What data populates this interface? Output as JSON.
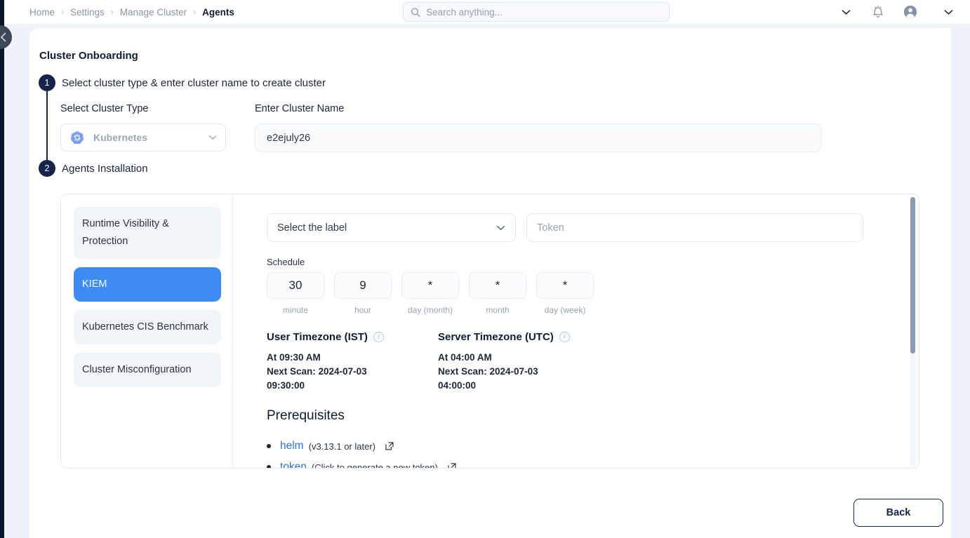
{
  "topbar": {
    "breadcrumb": [
      {
        "label": "Home",
        "active": false
      },
      {
        "label": "Settings",
        "active": false
      },
      {
        "label": "Manage Cluster",
        "active": false
      },
      {
        "label": "Agents",
        "active": true
      }
    ],
    "separator": "›",
    "search": {
      "placeholder": "Search anything...",
      "value": "",
      "icon": "search-icon"
    },
    "icons": [
      "chevron-down-icon",
      "bell-icon",
      "user-avatar-icon",
      "chevron-down-icon"
    ]
  },
  "page": {
    "title": "Cluster Onboarding"
  },
  "steps": [
    {
      "number": "1",
      "title": "Select cluster type & enter cluster name to create cluster"
    },
    {
      "number": "2",
      "title": "Agents Installation"
    }
  ],
  "cluster_form": {
    "type_label": "Select Cluster Type",
    "type_value": "Kubernetes",
    "name_label": "Enter Cluster Name",
    "name_value": "e2ejuly26"
  },
  "agents": {
    "items": [
      {
        "label": "Runtime Visibility & Protection",
        "selected": false
      },
      {
        "label": "KIEM",
        "selected": true
      },
      {
        "label": "Kubernetes CIS Benchmark",
        "selected": false
      },
      {
        "label": "Cluster Misconfiguration",
        "selected": false
      }
    ]
  },
  "config": {
    "label_select": "Select the label",
    "token_placeholder": "Token",
    "token_value": "",
    "schedule_label": "Schedule",
    "cron": [
      {
        "value": "30",
        "caption": "minute"
      },
      {
        "value": "9",
        "caption": "hour"
      },
      {
        "value": "*",
        "caption": "day (month)"
      },
      {
        "value": "*",
        "caption": "month"
      },
      {
        "value": "*",
        "caption": "day (week)"
      }
    ],
    "timezones": [
      {
        "heading": "User Timezone (IST)",
        "line1": "At 09:30 AM",
        "line2": "Next Scan: 2024-07-03",
        "line3": "09:30:00"
      },
      {
        "heading": "Server Timezone (UTC)",
        "line1": "At 04:00 AM",
        "line2": "Next Scan: 2024-07-03",
        "line3": "04:00:00"
      }
    ],
    "prerequisites_title": "Prerequisites",
    "prerequisites": [
      {
        "name": "helm",
        "note": "(v3.13.1 or later)"
      },
      {
        "name": "token",
        "note": "(Click to generate a new token)"
      }
    ]
  },
  "footer": {
    "back_label": "Back"
  },
  "colors": {
    "accent_blue": "#3d8bf5",
    "link_blue": "#2f6fe0",
    "navy": "#16234a",
    "page_bg": "#eef1f7",
    "panel_bg": "#f1f4f9"
  }
}
